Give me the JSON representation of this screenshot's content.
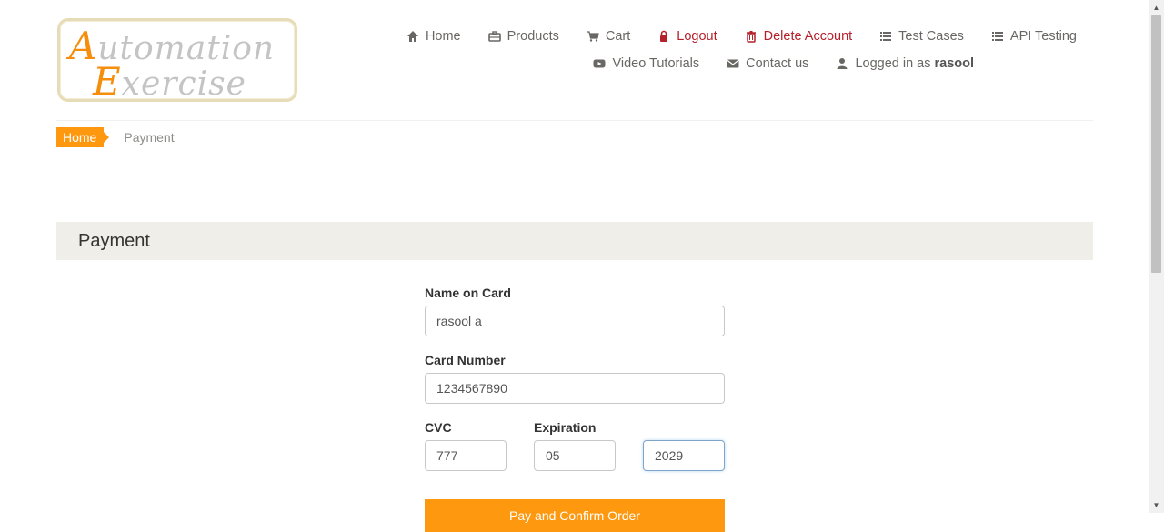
{
  "logo": {
    "line1_cap": "A",
    "line1_rest": "utomation",
    "line2_cap": "E",
    "line2_rest": "xercise"
  },
  "nav": {
    "row1": [
      {
        "label": "Home",
        "icon": "home-icon"
      },
      {
        "label": "Products",
        "icon": "briefcase-icon"
      },
      {
        "label": "Cart",
        "icon": "cart-icon"
      },
      {
        "label": "Logout",
        "icon": "lock-icon"
      },
      {
        "label": "Delete Account",
        "icon": "trash-icon"
      },
      {
        "label": "Test Cases",
        "icon": "list-icon"
      },
      {
        "label": "API Testing",
        "icon": "list-icon"
      }
    ],
    "row2": [
      {
        "label": "Video Tutorials",
        "icon": "youtube-icon"
      },
      {
        "label": "Contact us",
        "icon": "envelope-icon"
      },
      {
        "label": "Logged in as",
        "user": "rasool",
        "icon": "user-icon"
      }
    ]
  },
  "breadcrumb": {
    "home": "Home",
    "current": "Payment"
  },
  "heading": "Payment",
  "form": {
    "name_label": "Name on Card",
    "name_value": "rasool a",
    "card_label": "Card Number",
    "card_value": "1234567890",
    "cvc_label": "CVC",
    "cvc_value": "777",
    "expiration_label": "Expiration",
    "month_value": "05",
    "year_value": "2029",
    "submit_label": "Pay and Confirm Order"
  },
  "colors": {
    "accent": "#fe980f",
    "danger": "#b5202a",
    "heading_bg": "#efeee8"
  }
}
